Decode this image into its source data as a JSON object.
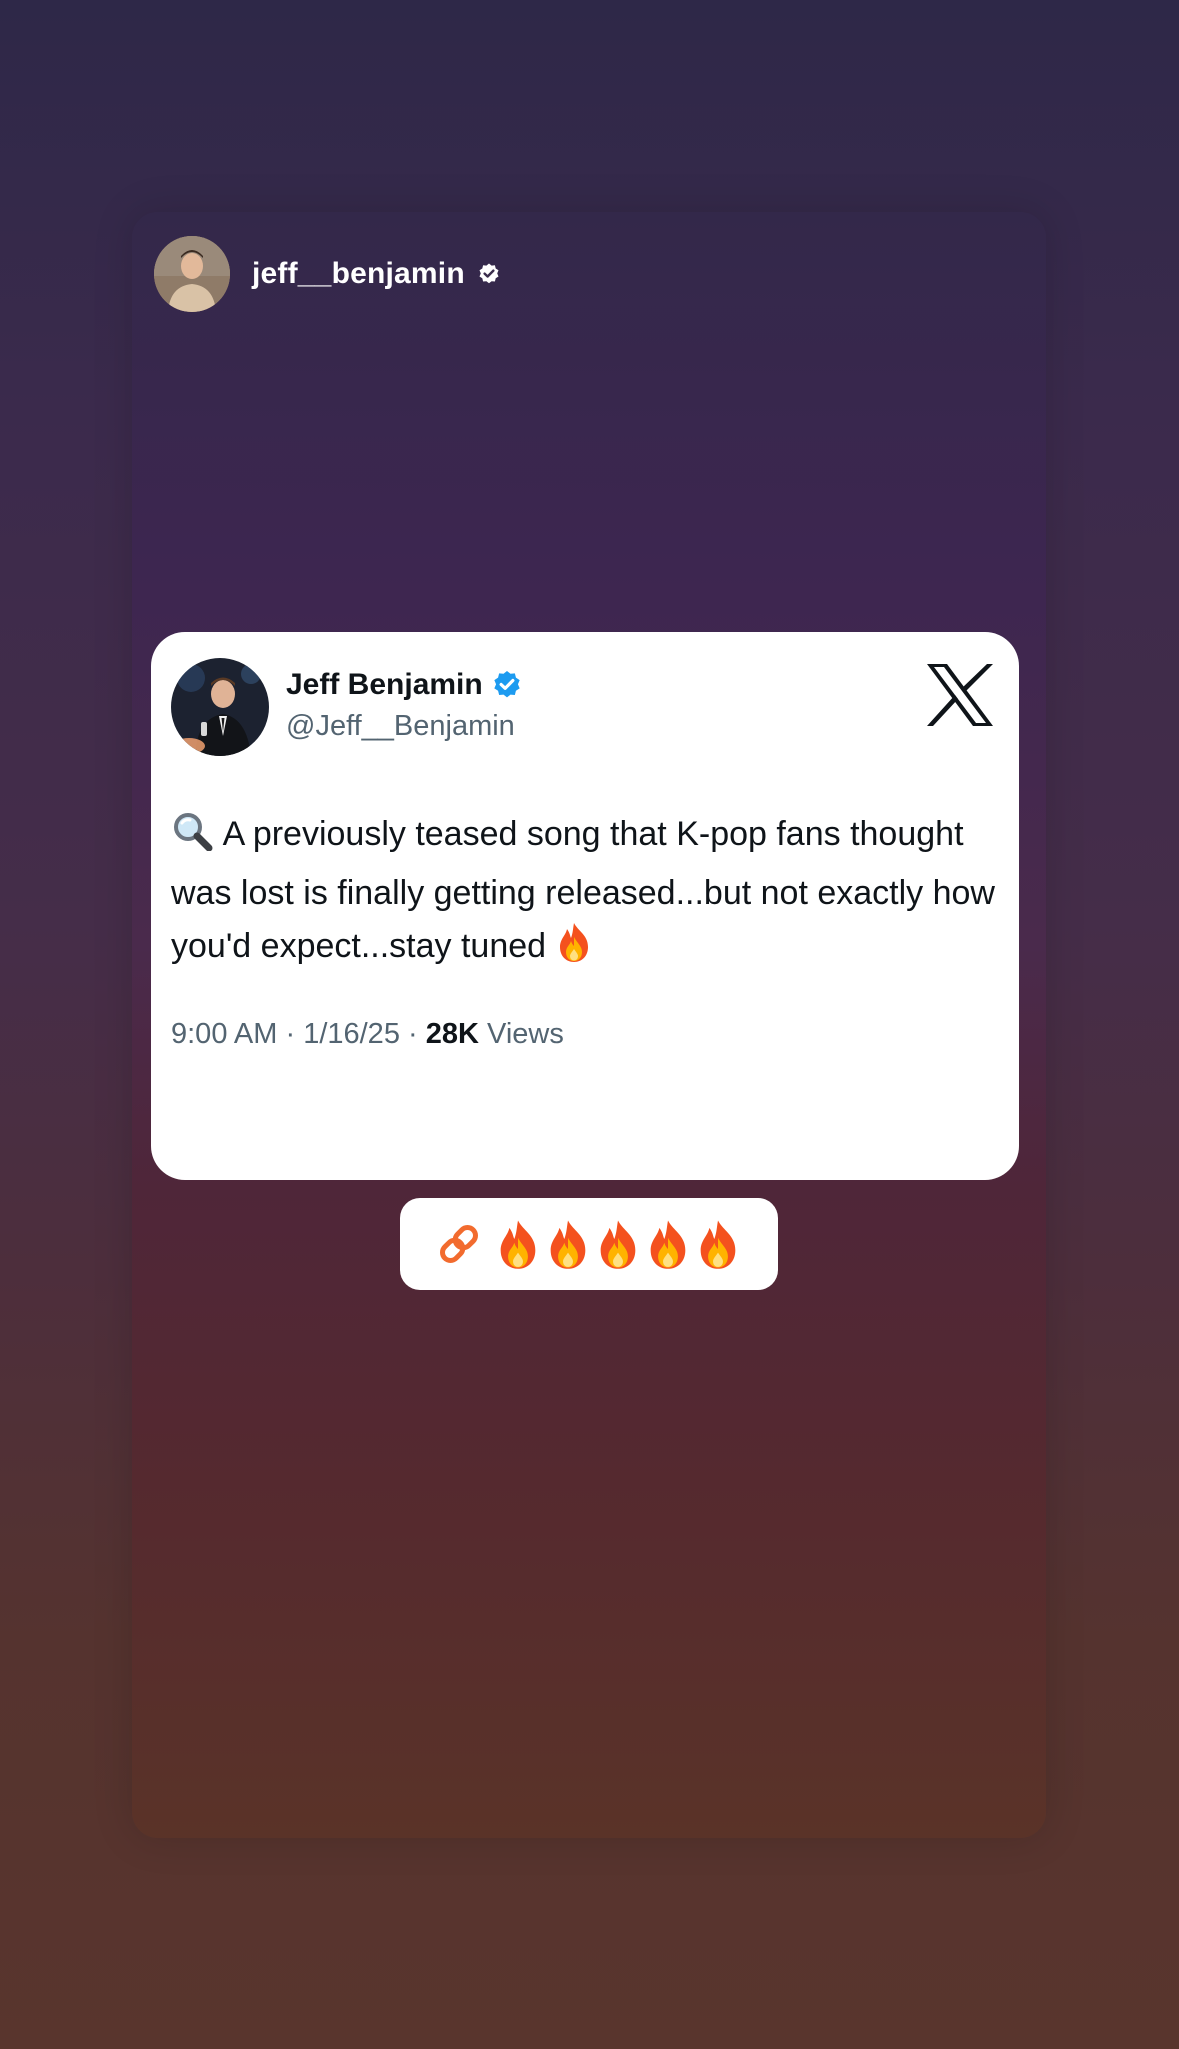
{
  "story": {
    "username": "jeff__benjamin",
    "verified_icon": "verified-badge-icon",
    "sticker": {
      "link_icon": "link-icon",
      "emoji": [
        "🔥",
        "🔥",
        "🔥",
        "🔥",
        "🔥"
      ]
    }
  },
  "tweet": {
    "display_name": "Jeff Benjamin",
    "handle": "@Jeff__Benjamin",
    "platform_icon": "x-logo-icon",
    "text_prefix_emoji": "🔍",
    "text": " A previously teased song that K-pop fans thought was lost is finally getting released...but not exactly how you'd expect...stay tuned ",
    "text_suffix_emoji": "🔥",
    "time": "9:00 AM",
    "date": "1/16/25",
    "separator": " · ",
    "views_count": "28K",
    "views_label": " Views"
  },
  "colors": {
    "x_verified_blue": "#1d9bf0",
    "link_orange": "#f26b2e",
    "text_primary": "#0f1419",
    "text_secondary": "#536471"
  }
}
